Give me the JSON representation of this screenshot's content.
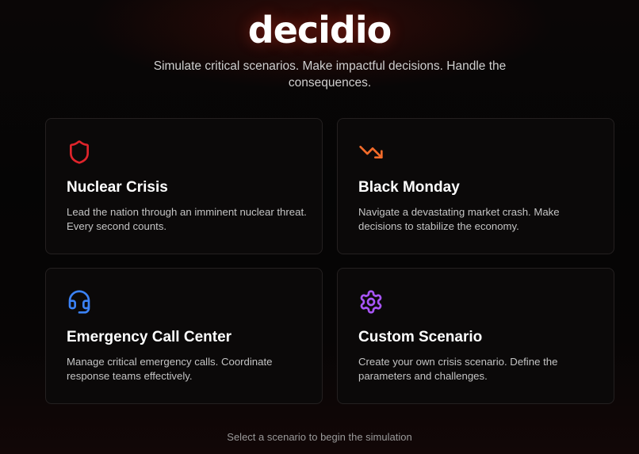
{
  "app": {
    "logo_text": "decidio",
    "tagline": "Simulate critical scenarios. Make impactful decisions. Handle the consequences."
  },
  "scenarios": [
    {
      "icon": "shield-icon",
      "icon_color": "#e0242b",
      "title": "Nuclear Crisis",
      "description": "Lead the nation through an imminent nuclear threat. Every second counts."
    },
    {
      "icon": "trending-down-icon",
      "icon_color": "#f26b2a",
      "title": "Black Monday",
      "description": "Navigate a devastating market crash. Make decisions to stabilize the economy."
    },
    {
      "icon": "headset-icon",
      "icon_color": "#3b82f6",
      "title": "Emergency Call Center",
      "description": "Manage critical emergency calls. Coordinate response teams effectively."
    },
    {
      "icon": "gear-icon",
      "icon_color": "#a855f7",
      "title": "Custom Scenario",
      "description": "Create your own crisis scenario. Define the parameters and challenges."
    }
  ],
  "footer": {
    "hint": "Select a scenario to begin the simulation"
  }
}
